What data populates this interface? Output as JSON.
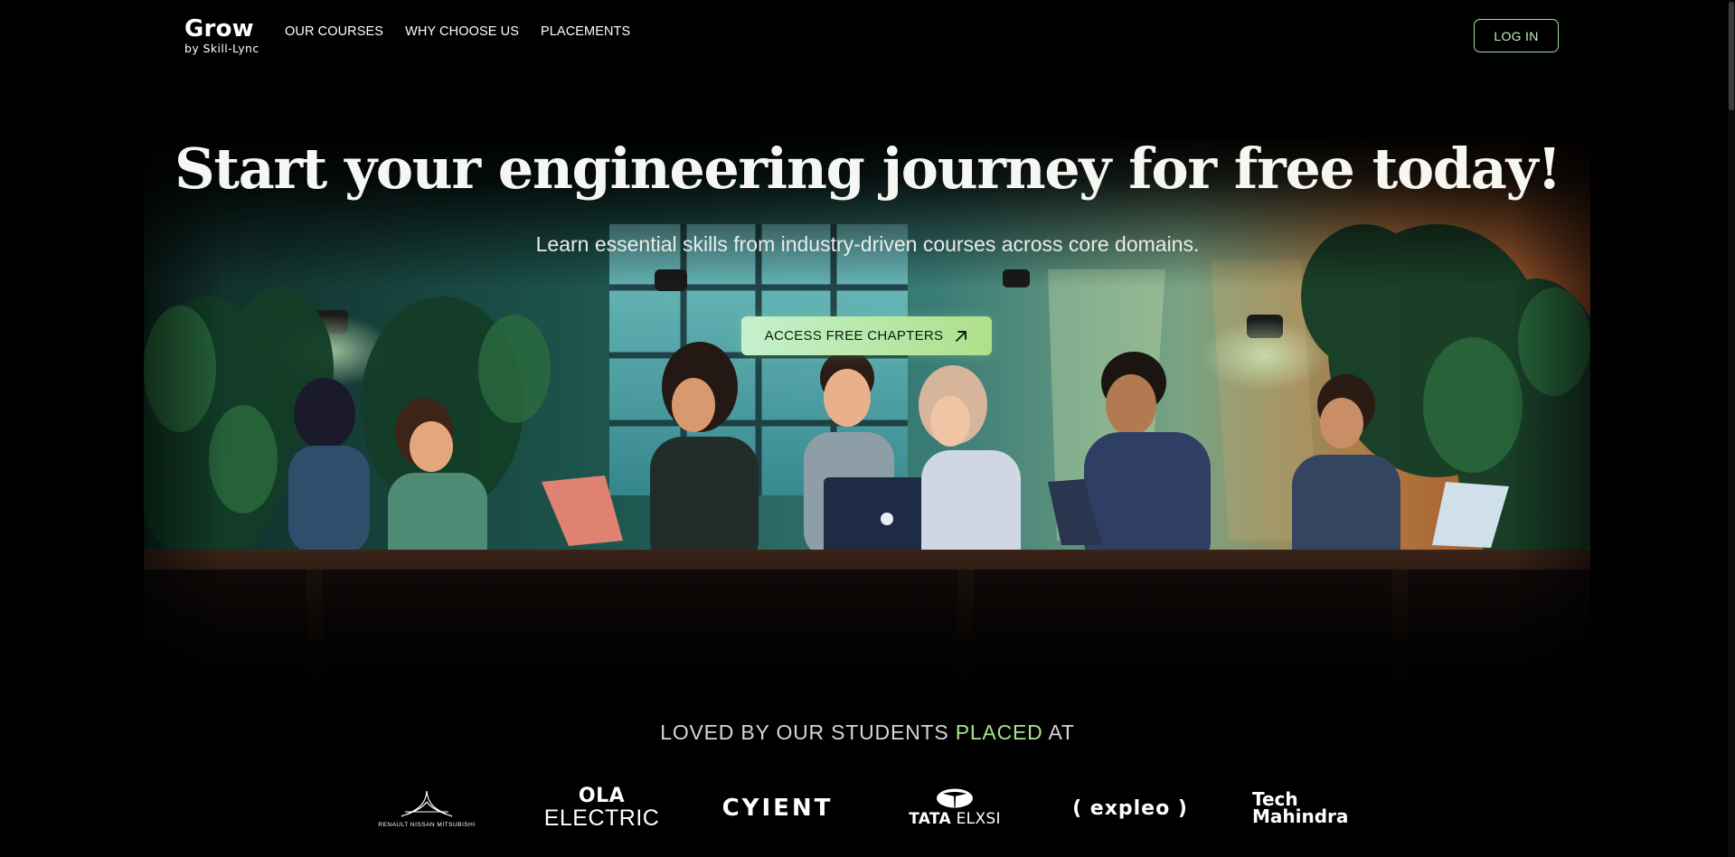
{
  "nav": {
    "logo_grow": "Grow",
    "logo_by": "by Skill-Lync",
    "links": [
      "OUR COURSES",
      "WHY CHOOSE US",
      "PLACEMENTS"
    ],
    "login_label": "LOG IN"
  },
  "hero": {
    "title": "Start your engineering journey for free today!",
    "subtitle": "Learn essential skills from industry-driven courses across core domains.",
    "cta_label": "ACCESS FREE CHAPTERS",
    "cta_icon": "arrow-up-right-icon"
  },
  "placed": {
    "prefix": "LOVED BY OUR STUDENTS ",
    "highlight": "PLACED",
    "suffix": " AT"
  },
  "partners": {
    "rnm": "RENAULT NISSAN MITSUBISHI",
    "ola_top": "OLA",
    "ola_bottom": "ELECTRIC",
    "cyient": "CYIENT",
    "tata_bold": "TATA",
    "tata_rest": " ELXSI",
    "expleo": "( expleo )",
    "tm_top": "Tech",
    "tm_bottom": "Mahindra"
  },
  "colors": {
    "accent": "#a7e48e",
    "cta_start": "#c4f1cd",
    "cta_end": "#aee08a",
    "background": "#000000"
  }
}
